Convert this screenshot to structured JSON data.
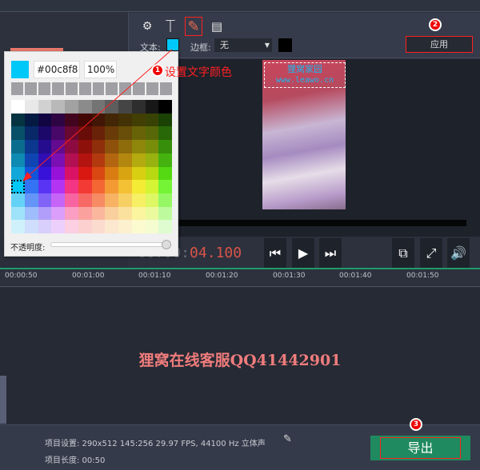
{
  "toolbar": {
    "tools": [
      "settings-icon",
      "text-icon",
      "eyedropper-icon",
      "save-icon"
    ],
    "text_label": "文本:",
    "text_color": "#00c8f8",
    "border_label": "边框:",
    "border_value": "无",
    "border_color": "#000000",
    "apply_label": "应用"
  },
  "color_picker": {
    "hex_value": "#00c8f8",
    "opacity_value": "100%",
    "opacity_label": "不透明度:",
    "opacity": 1.0,
    "selected_color": "#00c8f8"
  },
  "annotations": {
    "step1": "1",
    "step1_text": "设置文字颜色",
    "step2": "2",
    "step3": "3",
    "accent": "#ff0000"
  },
  "preview": {
    "caption_line1": "狸窝家园",
    "caption_line2": "www.leawo.cn",
    "caption_color": "#1ab8f0"
  },
  "player": {
    "timecode_prefix": "00:00:",
    "timecode": "04.100"
  },
  "ruler": {
    "ticks": [
      "00:00:50",
      "00:01:00",
      "00:01:10",
      "00:01:20",
      "00:01:30",
      "00:01:40",
      "00:01:50"
    ]
  },
  "timeline": {
    "watermark": "狸窝在线客服QQ41442901"
  },
  "footer": {
    "settings": "项目设置: 290x512 145:256 29.97 FPS, 44100 Hz 立体声",
    "length": "项目长度: 00:50",
    "export_label": "导出",
    "export_color": "#1f8a5f"
  }
}
